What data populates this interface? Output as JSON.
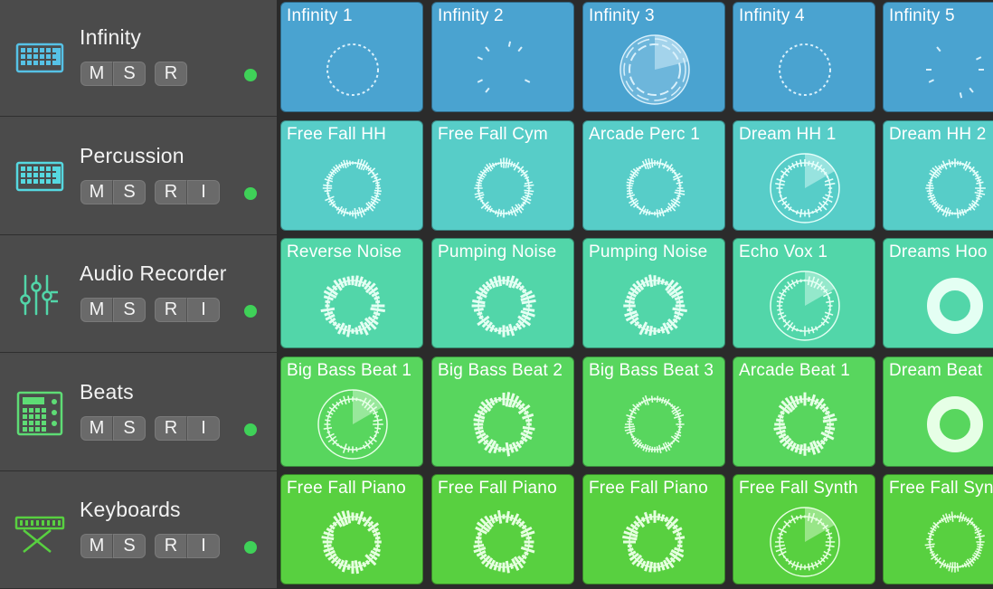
{
  "tracks": [
    {
      "name": "Infinity",
      "icon": "drum-machine-icon",
      "buttons": [
        [
          "M",
          "S"
        ],
        [
          "R"
        ]
      ]
    },
    {
      "name": "Percussion",
      "icon": "drum-machine-icon",
      "buttons": [
        [
          "M",
          "S"
        ],
        [
          "R",
          "I"
        ]
      ]
    },
    {
      "name": "Audio Recorder",
      "icon": "audio-recorder-icon",
      "buttons": [
        [
          "M",
          "S"
        ],
        [
          "R",
          "I"
        ]
      ]
    },
    {
      "name": "Beats",
      "icon": "beat-machine-icon",
      "buttons": [
        [
          "M",
          "S"
        ],
        [
          "R",
          "I"
        ]
      ]
    },
    {
      "name": "Keyboards",
      "icon": "keyboard-stand-icon",
      "buttons": [
        [
          "M",
          "S"
        ],
        [
          "R",
          "I"
        ]
      ]
    }
  ],
  "rows": [
    {
      "color": "#4aa3d0",
      "accent": "#d9f0fb",
      "cells": [
        "Infinity 1",
        "Infinity 2",
        "Infinity 3",
        "Infinity 4",
        "Infinity 5"
      ]
    },
    {
      "color": "#57cdc8",
      "accent": "#e6fffb",
      "cells": [
        "Free Fall HH",
        "Free Fall Cym",
        "Arcade Perc 1",
        "Dream HH 1",
        "Dream HH 2"
      ]
    },
    {
      "color": "#52d6a9",
      "accent": "#e4fff3",
      "cells": [
        "Reverse Noise",
        "Pumping Noise",
        "Pumping Noise",
        "Echo Vox 1",
        "Dreams Hoo"
      ]
    },
    {
      "color": "#58d65e",
      "accent": "#e6ffe6",
      "cells": [
        "Big Bass Beat 1",
        "Big Bass Beat 2",
        "Big Bass Beat 3",
        "Arcade Beat 1",
        "Dream Beat"
      ]
    },
    {
      "color": "#58d040",
      "accent": "#e6ffe0",
      "cells": [
        "Free Fall Piano",
        "Free Fall Piano",
        "Free Fall Piano",
        "Free Fall Synth",
        "Free Fall Syn"
      ]
    }
  ],
  "led_color": "#3fd158"
}
